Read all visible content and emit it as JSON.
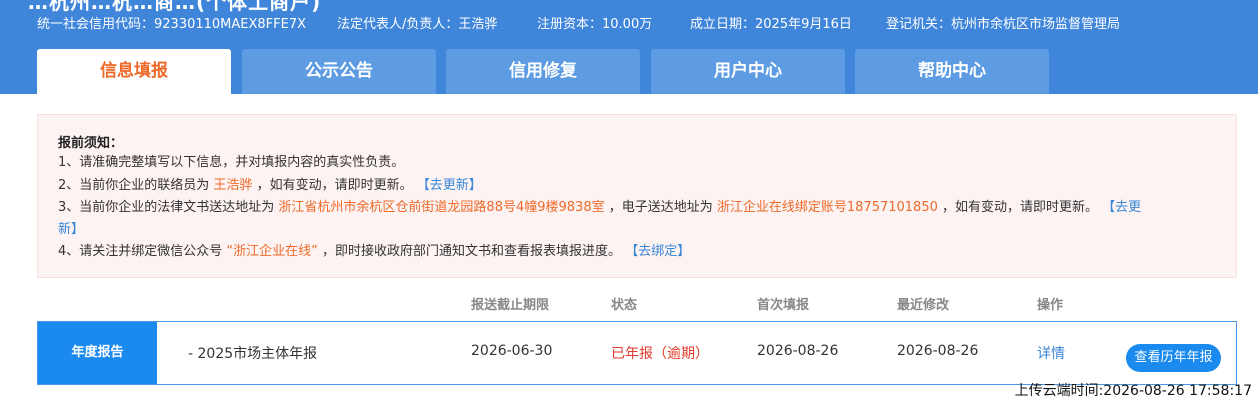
{
  "company": {
    "title_partial": "…杭州…杭…商…(个体工商户)",
    "info": [
      "统一社会信用代码：92330110MAEX8FFE7X",
      "法定代表人/负责人：王浩骅",
      "注册资本：10.00万",
      "成立日期：2025年9月16日",
      "登记机关：杭州市余杭区市场监督管理局"
    ]
  },
  "tabs": [
    "信息填报",
    "公示公告",
    "信用修复",
    "用户中心",
    "帮助中心"
  ],
  "notice": {
    "title": "报前须知：",
    "line1": "1、请准确完整填写以下信息，并对填报内容的真实性负责。",
    "line2": {
      "prefix": "2、当前你企业的联络员为",
      "name": "王浩骅",
      "suffix": "，如有变动，请即时更新。",
      "link": "【去更新】"
    },
    "line3": {
      "prefix": "3、当前你企业的法律文书送达地址为",
      "address": "浙江省杭州市余杭区仓前街道龙园路88号4幢9楼9838室",
      "mid": "，电子送达地址为",
      "eaddress": "浙江企业在线绑定账号18757101850",
      "suffix": "，如有变动，请即时更新。",
      "link_a": "【去更",
      "link_b": "新】"
    },
    "line4": {
      "prefix": "4、请关注并绑定微信公众号",
      "account": "“浙江企业在线”",
      "suffix": "，即时接收政府部门通知文书和查看报表填报进度。",
      "link": "【去绑定】"
    }
  },
  "table": {
    "headers": [
      "报送截止期限",
      "状态",
      "首次填报",
      "最近修改",
      "操作"
    ],
    "row": {
      "label": "年度报告",
      "name": "- 2025市场主体年报",
      "deadline": "2026-06-30",
      "status": "已年报（逾期）",
      "first": "2026-08-26",
      "last": "2026-08-26",
      "detail": "详情",
      "history": "查看历年年报"
    }
  },
  "footer": "上传云端时间:2026-08-26 17:58:17",
  "colors": {
    "header": "#3f86db",
    "accent": "#ee6a2b",
    "link": "#3886d6",
    "status_red": "#e03a2b",
    "primary": "#1a8aef"
  }
}
